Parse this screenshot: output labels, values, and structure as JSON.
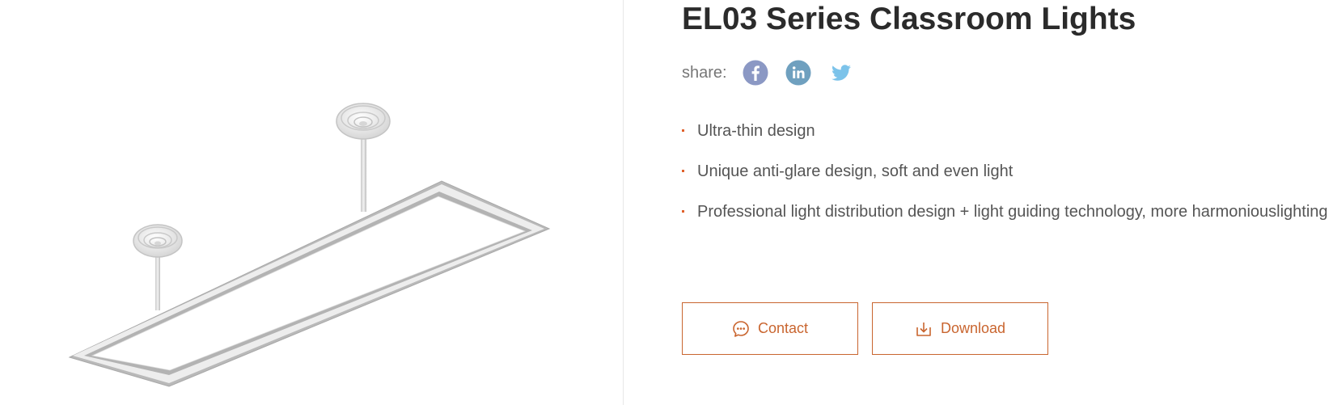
{
  "product": {
    "title": "EL03 Series Classroom Lights",
    "image_icon": "suspended-led-panel-light"
  },
  "share": {
    "label": "share:",
    "networks": [
      {
        "name": "facebook",
        "icon": "facebook-icon",
        "color": "#8b98c4"
      },
      {
        "name": "linkedin",
        "icon": "linkedin-icon",
        "color": "#6fa0bf"
      },
      {
        "name": "twitter",
        "icon": "twitter-icon",
        "color": "#7cc3ea"
      }
    ]
  },
  "features": [
    "Ultra-thin design",
    "Unique anti-glare design, soft and even light",
    "Professional light distribution design + light guiding technology, more harmoniouslighting"
  ],
  "actions": {
    "contact_label": "Contact",
    "download_label": "Download"
  },
  "colors": {
    "accent": "#c9652f",
    "bullet": "#e0602a",
    "title": "#2b2b2b",
    "body_text": "#555555",
    "divider": "#e8e8e8"
  }
}
